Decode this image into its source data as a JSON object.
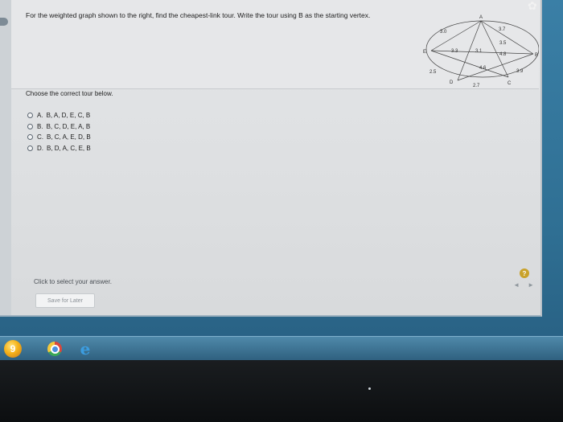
{
  "question": {
    "text": "For the weighted graph shown to the right, find the cheapest-link tour. Write the tour using B as the starting vertex."
  },
  "graph": {
    "vertices": [
      "A",
      "B",
      "C",
      "D",
      "E"
    ],
    "edge_weights": [
      "3.0",
      "3.7",
      "3.5",
      "4.8",
      "3.3",
      "3.1",
      "4.6",
      "2.5",
      "2.7",
      "3.9"
    ]
  },
  "prompt": "Choose the correct tour below.",
  "options": [
    {
      "letter": "A.",
      "tour": "B, A, D, E, C, B"
    },
    {
      "letter": "B.",
      "tour": "B, C, D, E, A, B"
    },
    {
      "letter": "C.",
      "tour": "B, C, A, E, D, B"
    },
    {
      "letter": "D.",
      "tour": "B, D, A, C, E, B"
    }
  ],
  "footer": {
    "hint": "Click to select your answer.",
    "save_label": "Save for Later",
    "help_symbol": "?",
    "prev_symbol": "◄",
    "next_symbol": "►"
  },
  "icons": {
    "gear": "gear-icon",
    "start": "start-orb-icon",
    "chrome": "chrome-icon",
    "ie": "internet-explorer-icon"
  },
  "taskbar": {
    "start_glyph": "9",
    "ie_glyph": "e"
  }
}
